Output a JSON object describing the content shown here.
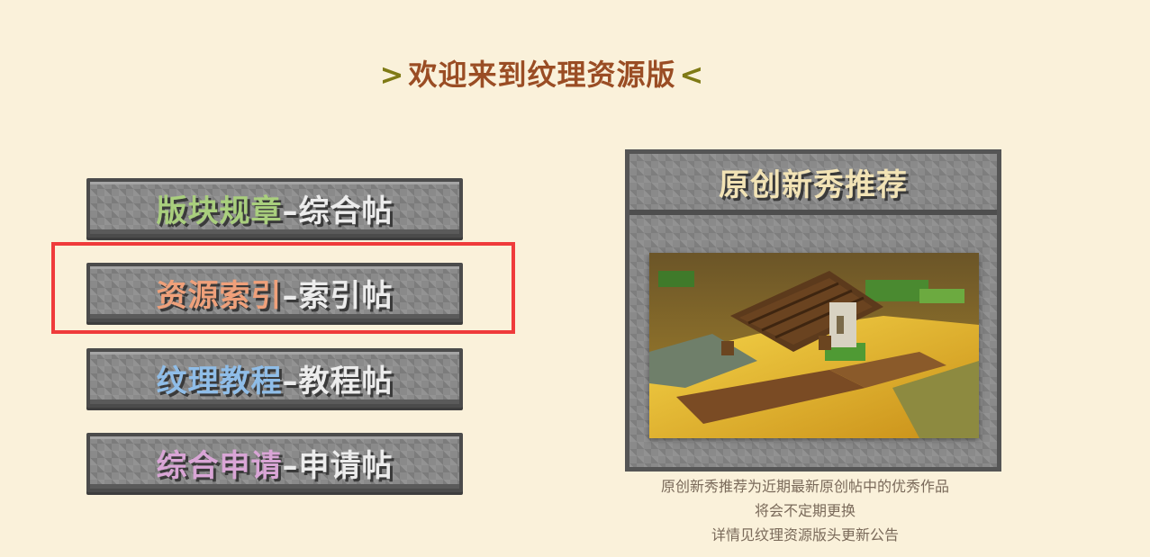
{
  "title": {
    "open": ">",
    "text": "欢迎来到纹理资源版",
    "close": "<",
    "text_color": "#9a4d24",
    "bracket_color": "#7f7a15"
  },
  "buttons": [
    {
      "highlight": "版块规章",
      "dash": "–",
      "suffix": "综合帖",
      "color": "#a9cf7d"
    },
    {
      "highlight": "资源索引",
      "dash": "–",
      "suffix": "索引帖",
      "color": "#efa07a"
    },
    {
      "highlight": "纹理教程",
      "dash": "–",
      "suffix": "教程帖",
      "color": "#8fbde8"
    },
    {
      "highlight": "综合申请",
      "dash": "–",
      "suffix": "申请帖",
      "color": "#d9a5d6"
    }
  ],
  "selected_button_index": 1,
  "highlight_color": "#ef3b3b",
  "panel": {
    "header": "原创新秀推荐",
    "image": "minecraft-house-render"
  },
  "caption": {
    "line1": "原创新秀推荐为近期最新原创帖中的优秀作品",
    "line2": "将会不定期更换",
    "line3": "详情见纹理资源版头更新公告"
  }
}
